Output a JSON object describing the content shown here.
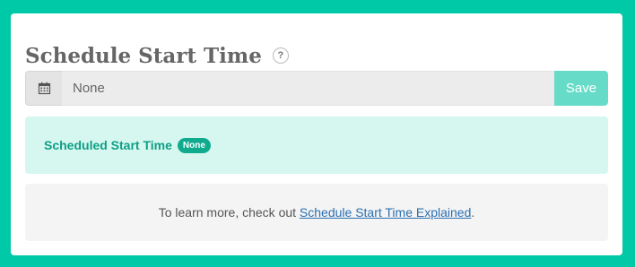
{
  "header": {
    "title": "Schedule Start Time",
    "help_icon_label": "?"
  },
  "schedule_form": {
    "calendar_icon": "calendar-icon",
    "input_placeholder": "None",
    "input_value": "",
    "save_label": "Save"
  },
  "status": {
    "label": "Scheduled Start Time",
    "badge": "None"
  },
  "info": {
    "prefix": "To learn more, check out ",
    "link_text": "Schedule Start Time Explained",
    "suffix": "."
  },
  "colors": {
    "background": "#00c9a7",
    "accent": "#10ab8f",
    "save_button": "#66dcc8",
    "status_box": "#d5f7ef",
    "link": "#2a6fb0"
  }
}
